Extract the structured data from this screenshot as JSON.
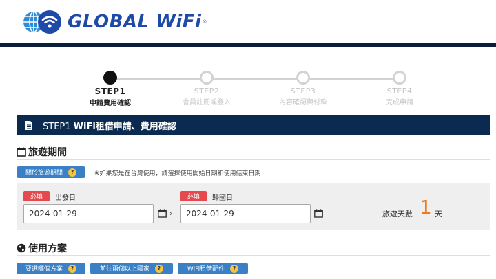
{
  "brand": {
    "name": "GLOBAL WiFi",
    "registered": "®",
    "color": "#1f4aa8"
  },
  "stepper": {
    "steps": [
      {
        "title": "STEP1",
        "subtitle": "申請費用確認",
        "active": true
      },
      {
        "title": "STEP2",
        "subtitle": "會員註冊或登入",
        "active": false
      },
      {
        "title": "STEP3",
        "subtitle": "內容確認與付款",
        "active": false
      },
      {
        "title": "STEP4",
        "subtitle": "完成申請",
        "active": false
      }
    ]
  },
  "banner": {
    "prefix": "STEP1",
    "title": "WiFi租借申請、費用確認",
    "icon": "document-icon"
  },
  "travel_period": {
    "heading": "旅遊期間",
    "icon": "calendar-icon",
    "help_button": "關於旅遊期間",
    "note": "※如果您是在台灣使用，請選擇使用開始日期和使用結束日期",
    "required_label": "必填",
    "departure_label": "出發日",
    "departure_value": "2024-01-29",
    "return_label": "歸國日",
    "return_value": "2024-01-29",
    "chevron": "›",
    "days_label": "旅遊天數",
    "days_value": "1",
    "days_unit": "天"
  },
  "usage_plan": {
    "heading": "使用方案",
    "icon": "globe-icon",
    "buttons": [
      "要選哪個方案",
      "前往兩個以上國家",
      "WiFi租借配件"
    ]
  },
  "help_glyph": "?",
  "colors": {
    "navy": "#0b2a4f",
    "button_blue": "#3a80c6",
    "required_red": "#e5484d",
    "days_orange": "#f07b1c",
    "help_yellow": "#f6c343"
  }
}
